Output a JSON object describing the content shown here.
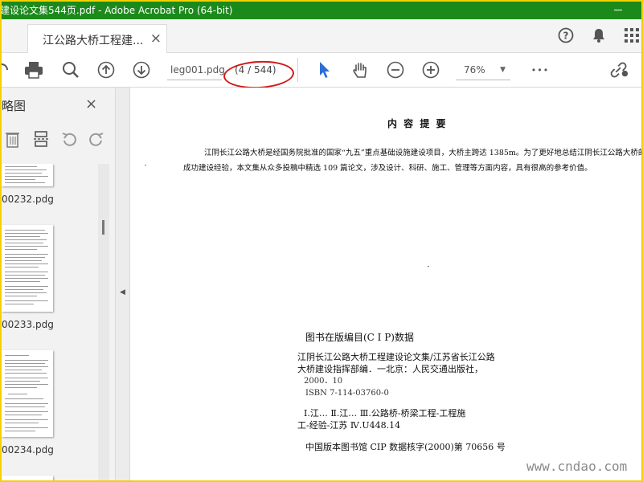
{
  "window": {
    "title": "建设论文集544页.pdf - Adobe Acrobat Pro (64-bit)"
  },
  "tab": {
    "label": "江公路大桥工程建...",
    "close_glyph": "×"
  },
  "toolbar": {
    "file_name": "leg001.pdg",
    "page_indicator": "(4 / 544)",
    "zoom": "76%",
    "more_glyph": "•••"
  },
  "sidebar": {
    "title": "略图",
    "close_glyph": "×",
    "thumbnails": [
      {
        "label": "00232.pdg"
      },
      {
        "label": "00233.pdg"
      },
      {
        "label": "00234.pdg"
      }
    ]
  },
  "document": {
    "abstract_title": "内 容 提 要",
    "abstract_body": "江阴长江公路大桥是经国务院批准的国家“九五”重点基础设施建设项目，大桥主跨达 1385m。为了更好地总结江阴长江公路大桥的成功建设经验，本文集从众多投稿中精选 109 篇论文，涉及设计、科研、施工、管理等方面内容，具有很高的参考价值。",
    "cip_title": "图书在版编目(C I P)数据",
    "cip_line1": "江阴长江公路大桥工程建设论文集/江苏省长江公路",
    "cip_line2": "大桥建设指挥部编．一北京：人民交通出版社，",
    "cip_line3": "2000．10",
    "cip_line4": "ISBN 7-114-03760-0",
    "cip_line5": "Ⅰ.江…   Ⅱ.江…   Ⅲ.公路桥-桥梁工程-工程施",
    "cip_line6": "工-经验-江苏  Ⅳ.U448.14",
    "cip_line7": "中国版本图书馆 CIP 数据核字(2000)第 70656 号"
  },
  "watermark": {
    "text": "www.cndao.com"
  },
  "colors": {
    "titlebar": "#1b8a1b",
    "frame": "#f5d000",
    "annotation": "#d11a1a",
    "accent": "#2b6fd6"
  }
}
